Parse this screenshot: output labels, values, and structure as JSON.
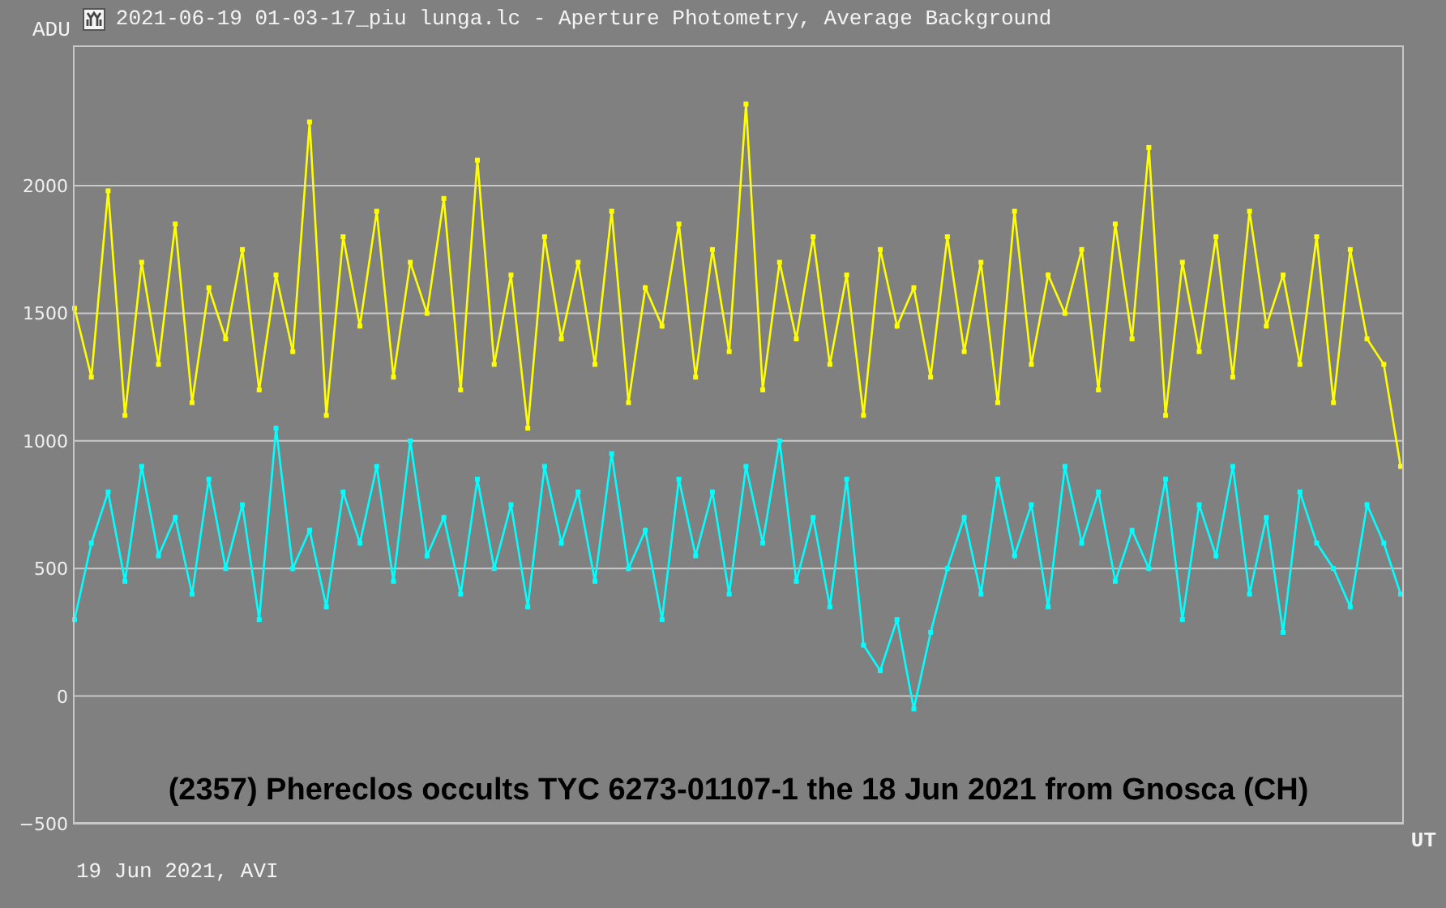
{
  "window": {
    "title": "2021-06-19 01-03-17_piu lunga.lc - Aperture Photometry, Average Background"
  },
  "plot": {
    "chart_data": {
      "type": "line",
      "grid": true,
      "ylabel": "ADU",
      "xlabel": "UT",
      "ylim": [
        -500,
        2550
      ],
      "yticks": [
        {
          "value": -500,
          "label": "−500"
        },
        {
          "value": 0,
          "label": "0"
        },
        {
          "value": 500,
          "label": "500"
        },
        {
          "value": 1000,
          "label": "1000"
        },
        {
          "value": 1500,
          "label": "1500"
        },
        {
          "value": 2000,
          "label": "2000"
        }
      ],
      "series": [
        {
          "color": "#ffff00",
          "marker": "square",
          "values": [
            1520,
            1250,
            1980,
            1100,
            1700,
            1300,
            1850,
            1150,
            1600,
            1400,
            1750,
            1200,
            1650,
            1350,
            2250,
            1100,
            1800,
            1450,
            1900,
            1250,
            1700,
            1500,
            1950,
            1200,
            2100,
            1300,
            1650,
            1050,
            1800,
            1400,
            1700,
            1300,
            1900,
            1150,
            1600,
            1450,
            1850,
            1250,
            1750,
            1350,
            2320,
            1200,
            1700,
            1400,
            1800,
            1300,
            1650,
            1100,
            1750,
            1450,
            1600,
            1250,
            1800,
            1350,
            1700,
            1150,
            1900,
            1300,
            1650,
            1500,
            1750,
            1200,
            1850,
            1400,
            2150,
            1100,
            1700,
            1350,
            1800,
            1250,
            1900,
            1450,
            1650,
            1300,
            1800,
            1150,
            1750,
            1400,
            1300,
            900
          ]
        },
        {
          "color": "#00ffff",
          "marker": "square",
          "values": [
            300,
            600,
            800,
            450,
            900,
            550,
            700,
            400,
            850,
            500,
            750,
            300,
            1050,
            500,
            650,
            350,
            800,
            600,
            900,
            450,
            1000,
            550,
            700,
            400,
            850,
            500,
            750,
            350,
            900,
            600,
            800,
            450,
            950,
            500,
            650,
            300,
            850,
            550,
            800,
            400,
            900,
            600,
            1000,
            450,
            700,
            350,
            850,
            200,
            100,
            300,
            -50,
            250,
            500,
            700,
            400,
            850,
            550,
            750,
            350,
            900,
            600,
            800,
            450,
            650,
            500,
            850,
            300,
            750,
            550,
            900,
            400,
            700,
            250,
            800,
            600,
            500,
            350,
            750,
            600,
            400
          ]
        }
      ],
      "annotations": [
        "(2357) Phereclos occults TYC 6273-01107-1 the 18 Jun 2021 from Gnosca (CH)"
      ]
    }
  },
  "footer": {
    "text": "19 Jun 2021, AVI"
  }
}
